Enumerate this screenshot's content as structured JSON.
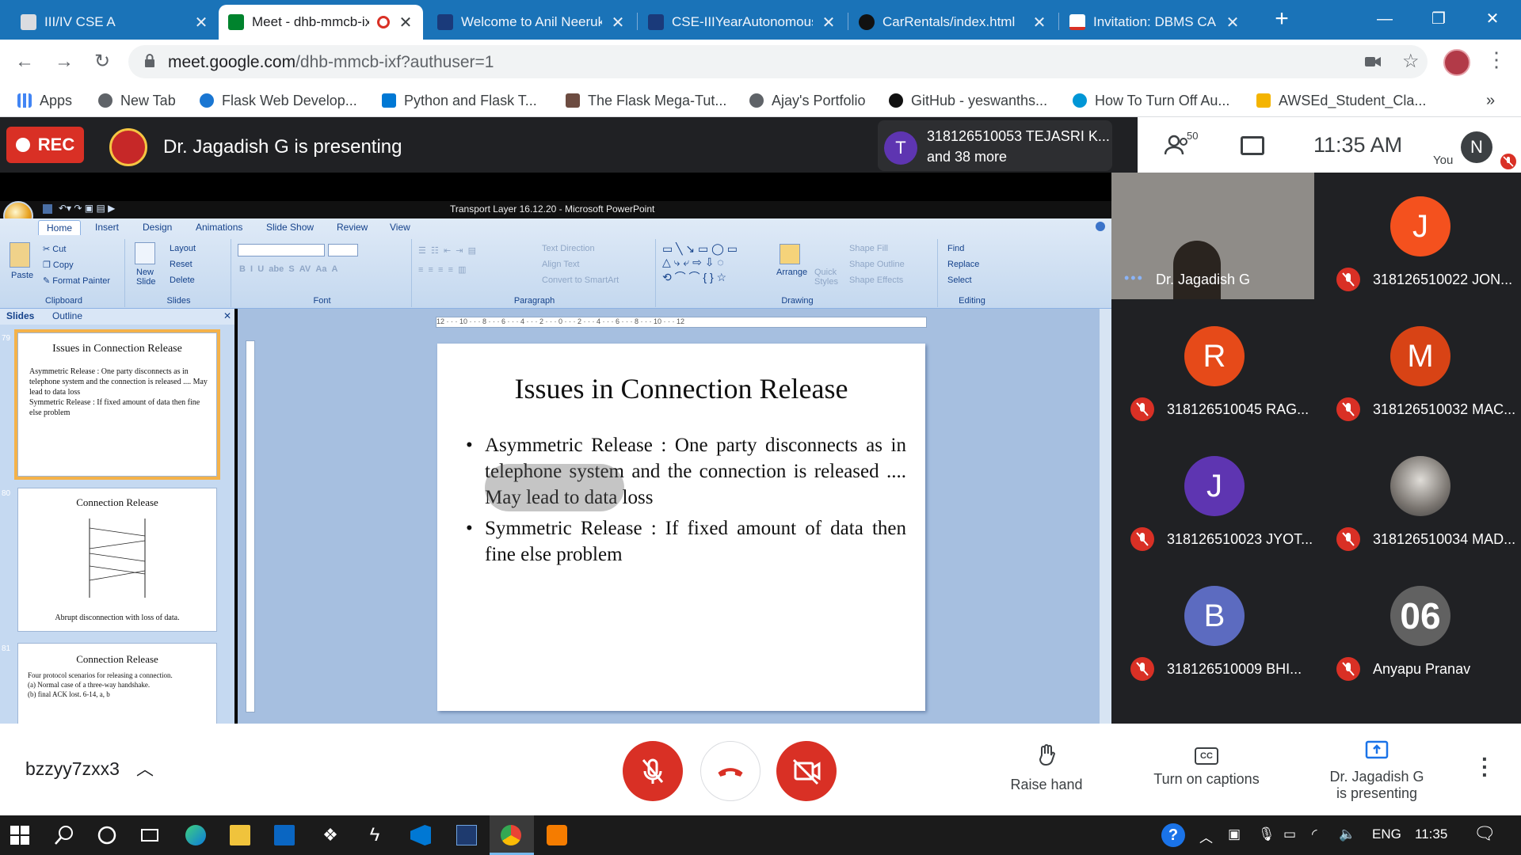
{
  "browser": {
    "tabs": [
      {
        "title": "III/IV CSE A",
        "color": "#5f6368"
      },
      {
        "title": "Meet - dhb-mmcb-ixf",
        "color": "#00832d",
        "active": true
      },
      {
        "title": "Welcome to Anil Neerukonda",
        "color": "#1a3a7a"
      },
      {
        "title": "CSE-IIIYearAutonomous",
        "color": "#1a3a7a"
      },
      {
        "title": "CarRentals/index.html",
        "color": "#111111"
      },
      {
        "title": "Invitation: DBMS CAI",
        "color": "#d93025"
      }
    ],
    "url_host": "meet.google.com",
    "url_path": "/dhb-mmcb-ixf?authuser=1",
    "bookmarks": [
      {
        "label": "Apps",
        "icon": "apps-grid-icon",
        "color": "#4285f4"
      },
      {
        "label": "New Tab",
        "icon": "globe-icon",
        "color": "#5f6368"
      },
      {
        "label": "Flask Web Develop...",
        "icon": "flask-icon",
        "color": "#1976d2"
      },
      {
        "label": "Python and Flask T...",
        "icon": "vscode-icon",
        "color": "#0078d4"
      },
      {
        "label": "The Flask Mega-Tut...",
        "icon": "blog-icon",
        "color": "#6d4c41"
      },
      {
        "label": "Ajay's Portfolio",
        "icon": "globe-icon",
        "color": "#5f6368"
      },
      {
        "label": "GitHub - yeswanths...",
        "icon": "github-icon",
        "color": "#111111"
      },
      {
        "label": "How To Turn Off Au...",
        "icon": "hp-icon",
        "color": "#0096d6"
      },
      {
        "label": "AWSEd_Student_Cla...",
        "icon": "aws-icon",
        "color": "#f4b400"
      }
    ]
  },
  "meet": {
    "rec_label": "REC",
    "presenting_text": "Dr. Jagadish G is presenting",
    "notification": {
      "avatar": "T",
      "line1": "318126510053 TEJASRI K...",
      "line2": "and 38 more"
    },
    "participant_count": "50",
    "time": "11:35 AM",
    "you_label": "You",
    "you_avatar": "N",
    "meeting_code": "bzzyy7zxx3",
    "controls": {
      "raise_hand": "Raise hand",
      "captions": "Turn on captions",
      "presenting_line1": "Dr. Jagadish G",
      "presenting_line2": "is presenting"
    },
    "participants": [
      {
        "name": "Dr. Jagadish G",
        "initial": "",
        "color": "#5a4a3a",
        "video": true,
        "muted": false
      },
      {
        "name": "318126510022 JON...",
        "initial": "J",
        "color": "#f4511e",
        "muted": true
      },
      {
        "name": "318126510045 RAG...",
        "initial": "R",
        "color": "#e64a19",
        "muted": true
      },
      {
        "name": "318126510032 MAC...",
        "initial": "M",
        "color": "#d84315",
        "muted": true
      },
      {
        "name": "318126510023 JYOT...",
        "initial": "J",
        "color": "#5e35b1",
        "muted": true
      },
      {
        "name": "318126510034 MAD...",
        "initial": "",
        "color": "#6d6d6d",
        "photo": true,
        "muted": true
      },
      {
        "name": "318126510009 BHI...",
        "initial": "B",
        "color": "#5c6bc0",
        "muted": true
      },
      {
        "name": "Anyapu Pranav",
        "initial": "06",
        "color": "#616161",
        "muted": true
      }
    ]
  },
  "powerpoint": {
    "window_title": "Transport Layer 16.12.20 - Microsoft PowerPoint",
    "tabs": [
      "Home",
      "Insert",
      "Design",
      "Animations",
      "Slide Show",
      "Review",
      "View"
    ],
    "groups": {
      "clipboard": {
        "label": "Clipboard",
        "paste": "Paste",
        "cut": "Cut",
        "copy": "Copy",
        "format_painter": "Format Painter"
      },
      "slides": {
        "label": "Slides",
        "new_slide": "New Slide",
        "layout": "Layout",
        "reset": "Reset",
        "delete": "Delete"
      },
      "font": {
        "label": "Font"
      },
      "paragraph": {
        "label": "Paragraph",
        "text_direction": "Text Direction",
        "align_text": "Align Text",
        "smartart": "Convert to SmartArt"
      },
      "drawing": {
        "label": "Drawing",
        "arrange": "Arrange",
        "quick_styles": "Quick Styles",
        "shape_fill": "Shape Fill",
        "shape_outline": "Shape Outline",
        "shape_effects": "Shape Effects"
      },
      "editing": {
        "label": "Editing",
        "find": "Find",
        "replace": "Replace",
        "select": "Select"
      }
    },
    "panel_tabs": [
      "Slides",
      "Outline"
    ],
    "thumbnails": [
      {
        "num": "79",
        "title": "Issues in Connection Release",
        "bullets": [
          "Asymmetric Release : One party disconnects as in telephone system and the connection is released .... May lead to data loss",
          "Symmetric Release : If fixed amount of data then fine else problem"
        ]
      },
      {
        "num": "80",
        "title": "Connection Release",
        "caption": "Abrupt disconnection with loss of data."
      },
      {
        "num": "81",
        "title": "Connection Release",
        "lines": [
          "Four protocol scenarios for releasing a connection.",
          "(a) Normal case of a three-way handshake.",
          "(b) final ACK lost. 6-14, a, b"
        ]
      }
    ],
    "ruler_text": "12 · · · 10 · · · 8 · · · 6 · · · 4 · · · 2 · · · 0 · · · 2 · · · 4 · · · 6 · · · 8 · · · 10 · · · 12",
    "slide": {
      "title": "Issues in Connection Release",
      "bullets": [
        "Asymmetric Release : One party disconnects as in telephone system and the connection is released .... May lead to data loss",
        "Symmetric Release : If fixed amount of data then fine else problem"
      ]
    }
  },
  "taskbar": {
    "language": "ENG",
    "time": "11:35"
  }
}
